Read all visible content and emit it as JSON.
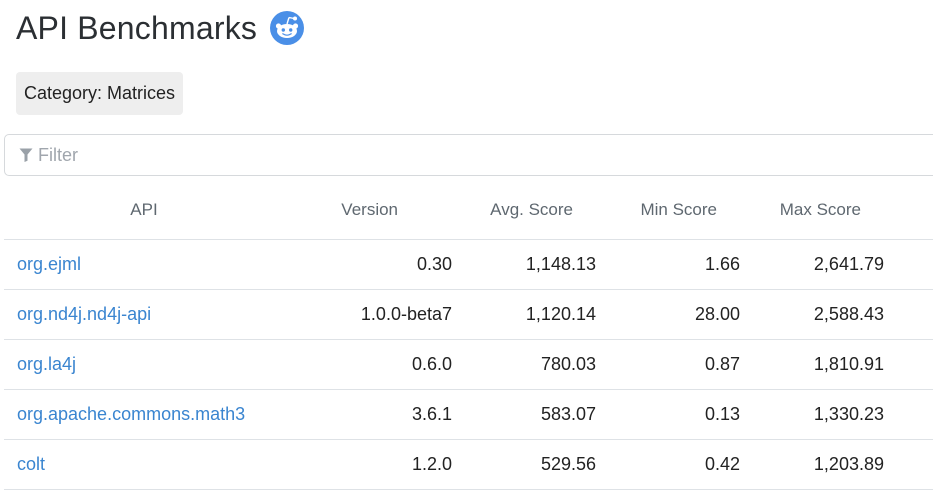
{
  "header": {
    "title": "API Benchmarks",
    "icon": "reddit-icon",
    "icon_color": "#4a8fe7"
  },
  "category": {
    "label": "Category: Matrices"
  },
  "filter": {
    "icon": "filter-icon",
    "placeholder": "Filter",
    "value": ""
  },
  "table": {
    "columns": [
      "API",
      "Version",
      "Avg. Score",
      "Min Score",
      "Max Score"
    ],
    "rows": [
      {
        "api": "org.ejml",
        "version": "0.30",
        "avg": "1,148.13",
        "min": "1.66",
        "max": "2,641.79"
      },
      {
        "api": "org.nd4j.nd4j-api",
        "version": "1.0.0-beta7",
        "avg": "1,120.14",
        "min": "28.00",
        "max": "2,588.43"
      },
      {
        "api": "org.la4j",
        "version": "0.6.0",
        "avg": "780.03",
        "min": "0.87",
        "max": "1,810.91"
      },
      {
        "api": "org.apache.commons.math3",
        "version": "3.6.1",
        "avg": "583.07",
        "min": "0.13",
        "max": "1,330.23"
      },
      {
        "api": "colt",
        "version": "1.2.0",
        "avg": "529.56",
        "min": "0.42",
        "max": "1,203.89"
      }
    ]
  },
  "colors": {
    "link": "#3a85d0",
    "badge_bg": "#eeeeee",
    "border": "#dee2e6"
  }
}
